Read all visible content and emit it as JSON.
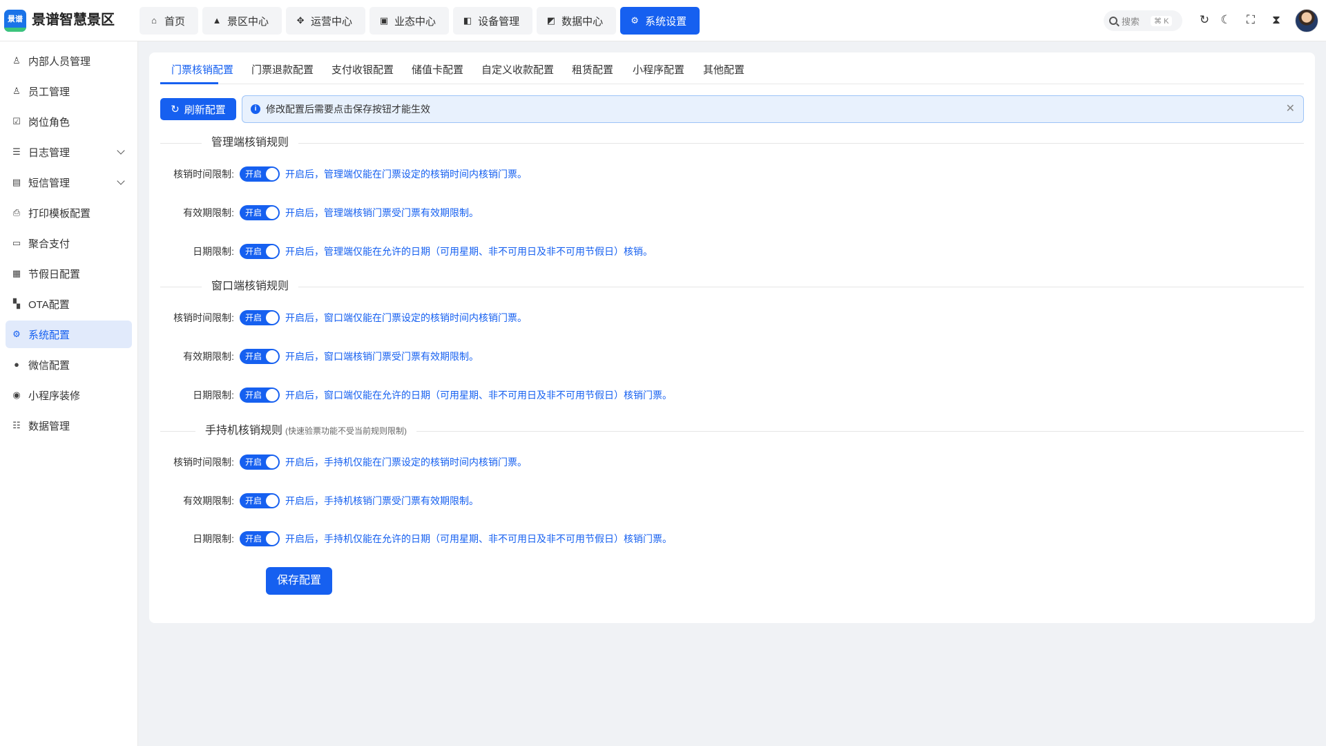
{
  "brand": {
    "logo_text": "景谱",
    "name": "景谱智慧景区"
  },
  "topnav": [
    {
      "label": "首页",
      "icon": "home-icon"
    },
    {
      "label": "景区中心",
      "icon": "mountain-icon"
    },
    {
      "label": "运营中心",
      "icon": "operations-icon"
    },
    {
      "label": "业态中心",
      "icon": "business-icon"
    },
    {
      "label": "设备管理",
      "icon": "device-icon"
    },
    {
      "label": "数据中心",
      "icon": "chart-icon"
    },
    {
      "label": "系统设置",
      "icon": "gear-icon"
    }
  ],
  "header": {
    "search_label": "搜索",
    "search_shortcut": "⌘ K"
  },
  "sidebar": {
    "items": [
      {
        "label": "内部人员管理",
        "icon": "user-icon"
      },
      {
        "label": "员工管理",
        "icon": "user-add-icon"
      },
      {
        "label": "岗位角色",
        "icon": "role-icon"
      },
      {
        "label": "日志管理",
        "icon": "log-icon"
      },
      {
        "label": "短信管理",
        "icon": "sms-icon"
      },
      {
        "label": "打印模板配置",
        "icon": "printer-icon"
      },
      {
        "label": "聚合支付",
        "icon": "wallet-icon"
      },
      {
        "label": "节假日配置",
        "icon": "calendar-icon"
      },
      {
        "label": "OTA配置",
        "icon": "grid-icon"
      },
      {
        "label": "系统配置",
        "icon": "settings-icon"
      },
      {
        "label": "微信配置",
        "icon": "wechat-icon"
      },
      {
        "label": "小程序装修",
        "icon": "miniprogram-icon"
      },
      {
        "label": "数据管理",
        "icon": "database-icon"
      }
    ]
  },
  "tabs": [
    "门票核销配置",
    "门票退款配置",
    "支付收银配置",
    "储值卡配置",
    "自定义收款配置",
    "租赁配置",
    "小程序配置",
    "其他配置"
  ],
  "toolbar": {
    "refresh_label": "刷新配置",
    "alert_text": "修改配置后需要点击保存按钮才能生效"
  },
  "sections": [
    {
      "title": "管理端核销规则",
      "note": "",
      "rows": [
        {
          "label": "核销时间限制:",
          "switch": "开启",
          "desc": "开启后，管理端仅能在门票设定的核销时间内核销门票。"
        },
        {
          "label": "有效期限制:",
          "switch": "开启",
          "desc": "开启后，管理端核销门票受门票有效期限制。"
        },
        {
          "label": "日期限制:",
          "switch": "开启",
          "desc": "开启后，管理端仅能在允许的日期（可用星期、非不可用日及非不可用节假日）核销。"
        }
      ]
    },
    {
      "title": "窗口端核销规则",
      "note": "",
      "rows": [
        {
          "label": "核销时间限制:",
          "switch": "开启",
          "desc": "开启后，窗口端仅能在门票设定的核销时间内核销门票。"
        },
        {
          "label": "有效期限制:",
          "switch": "开启",
          "desc": "开启后，窗口端核销门票受门票有效期限制。"
        },
        {
          "label": "日期限制:",
          "switch": "开启",
          "desc": "开启后，窗口端仅能在允许的日期（可用星期、非不可用日及非不可用节假日）核销门票。"
        }
      ]
    },
    {
      "title": "手持机核销规则",
      "note": "(快速验票功能不受当前规则限制)",
      "rows": [
        {
          "label": "核销时间限制:",
          "switch": "开启",
          "desc": "开启后，手持机仅能在门票设定的核销时间内核销门票。"
        },
        {
          "label": "有效期限制:",
          "switch": "开启",
          "desc": "开启后，手持机核销门票受门票有效期限制。"
        },
        {
          "label": "日期限制:",
          "switch": "开启",
          "desc": "开启后，手持机仅能在允许的日期（可用星期、非不可用日及非不可用节假日）核销门票。"
        }
      ]
    }
  ],
  "save_label": "保存配置",
  "colors": {
    "primary": "#1660f0",
    "active_bg": "#e1eafb",
    "alert_bg": "#e8f1fd"
  }
}
